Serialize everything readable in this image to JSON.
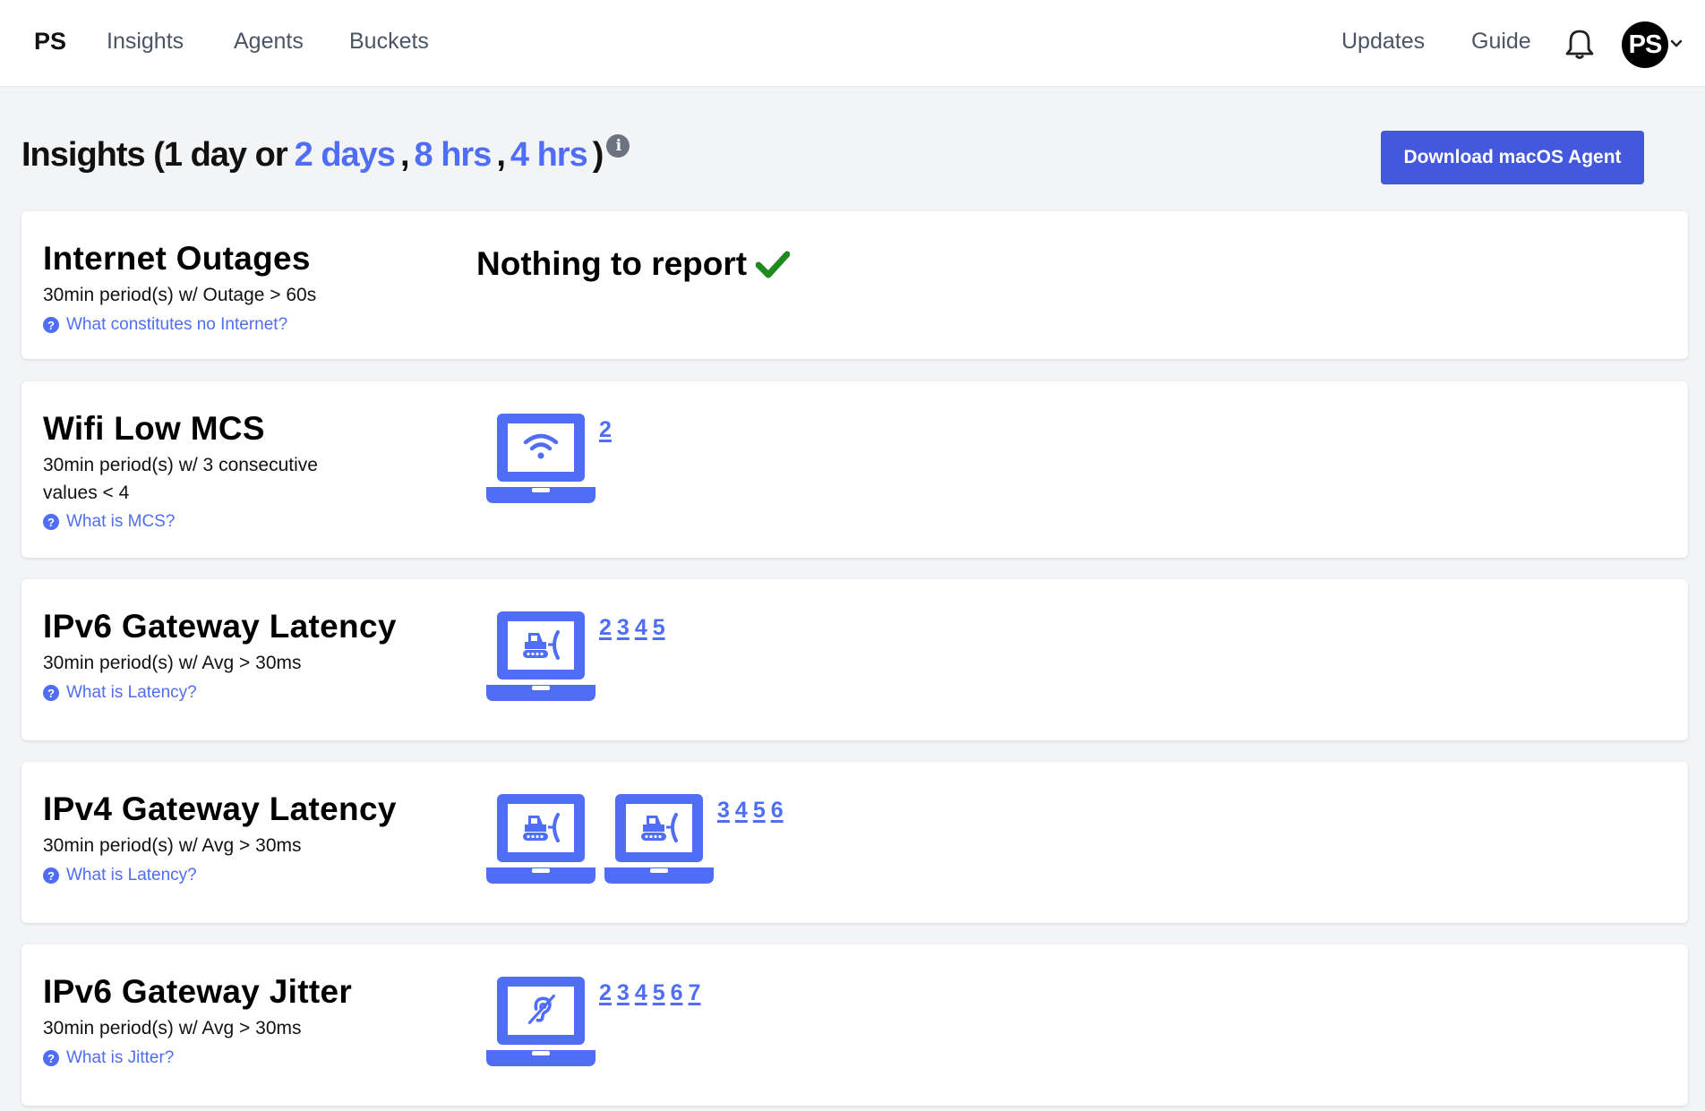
{
  "nav": {
    "brand": "PS",
    "links": [
      "Insights",
      "Agents",
      "Buckets"
    ],
    "right_links": [
      "Updates",
      "Guide"
    ],
    "avatar_initials": "PS",
    "bell_icon": "bell-icon"
  },
  "header": {
    "title_prefix": "Insights (1 day or",
    "range_links": [
      "2 days",
      "8 hrs",
      "4 hrs"
    ],
    "separator": ",",
    "title_suffix": ")",
    "info_icon_glyph": "i",
    "download_label": "Download macOS Agent"
  },
  "accent_color": "#4f6df5",
  "button_color": "#4358dc",
  "success_color": "#1f8a1f",
  "cards": [
    {
      "title": "Internet Outages",
      "desc": "30min period(s) w/ Outage > 60s",
      "help": "What constitutes no Internet?",
      "status": "Nothing to report",
      "status_icon": "checkmark-icon"
    },
    {
      "title": "Wifi Low MCS",
      "desc": "30min period(s) w/ 3 consecutive values < 4",
      "help": "What is MCS?",
      "device_icon": "laptop-wifi-icon",
      "numbers": [
        "2"
      ]
    },
    {
      "title": "IPv6 Gateway Latency",
      "desc": "30min period(s) w/ Avg > 30ms",
      "help": "What is Latency?",
      "device_icon": "laptop-bulldozer-icon",
      "numbers": [
        "2",
        "3",
        "4",
        "5"
      ]
    },
    {
      "title": "IPv4 Gateway Latency",
      "desc": "30min period(s) w/ Avg > 30ms",
      "help": "What is Latency?",
      "device_icon": "laptop-bulldozer-icon",
      "numbers": [
        "3",
        "4",
        "5",
        "6"
      ]
    },
    {
      "title": "IPv6 Gateway Jitter",
      "desc": "30min period(s) w/ Avg > 30ms",
      "help": "What is Jitter?",
      "device_icon": "laptop-hearing-icon",
      "numbers": [
        "2",
        "3",
        "4",
        "5",
        "6",
        "7"
      ]
    }
  ]
}
